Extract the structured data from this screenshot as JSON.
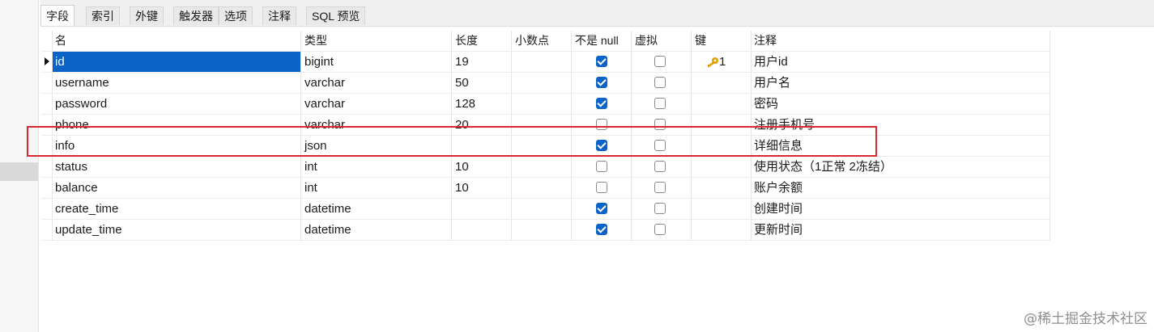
{
  "tabs": [
    "字段",
    "索引",
    "外键",
    "触发器",
    "选项",
    "注释",
    "SQL 预览"
  ],
  "columns": {
    "name": "名",
    "type": "类型",
    "length": "长度",
    "decimals": "小数点",
    "not_null": "不是 null",
    "virtual": "虚拟",
    "key": "键",
    "comment": "注释"
  },
  "rows": [
    {
      "name": "id",
      "type": "bigint",
      "length": "19",
      "not_null": true,
      "virtual": false,
      "key": "1",
      "comment": "用户id"
    },
    {
      "name": "username",
      "type": "varchar",
      "length": "50",
      "not_null": true,
      "virtual": false,
      "key": "",
      "comment": "用户名"
    },
    {
      "name": "password",
      "type": "varchar",
      "length": "128",
      "not_null": true,
      "virtual": false,
      "key": "",
      "comment": "密码"
    },
    {
      "name": "phone",
      "type": "varchar",
      "length": "20",
      "not_null": false,
      "virtual": false,
      "key": "",
      "comment": "注册手机号"
    },
    {
      "name": "info",
      "type": "json",
      "length": "",
      "not_null": true,
      "virtual": false,
      "key": "",
      "comment": "详细信息"
    },
    {
      "name": "status",
      "type": "int",
      "length": "10",
      "not_null": false,
      "virtual": false,
      "key": "",
      "comment": "使用状态（1正常 2冻结）"
    },
    {
      "name": "balance",
      "type": "int",
      "length": "10",
      "not_null": false,
      "virtual": false,
      "key": "",
      "comment": "账户余额"
    },
    {
      "name": "create_time",
      "type": "datetime",
      "length": "",
      "not_null": true,
      "virtual": false,
      "key": "",
      "comment": "创建时间"
    },
    {
      "name": "update_time",
      "type": "datetime",
      "length": "",
      "not_null": true,
      "virtual": false,
      "key": "",
      "comment": "更新时间"
    }
  ],
  "watermark": "@稀土掘金技术社区",
  "colors": {
    "accent": "#0a64c8",
    "highlight": "#d9282f",
    "key_icon": "#e0a100"
  },
  "icons": {
    "key": "key-icon",
    "row_marker": "current-row-arrow-icon"
  }
}
